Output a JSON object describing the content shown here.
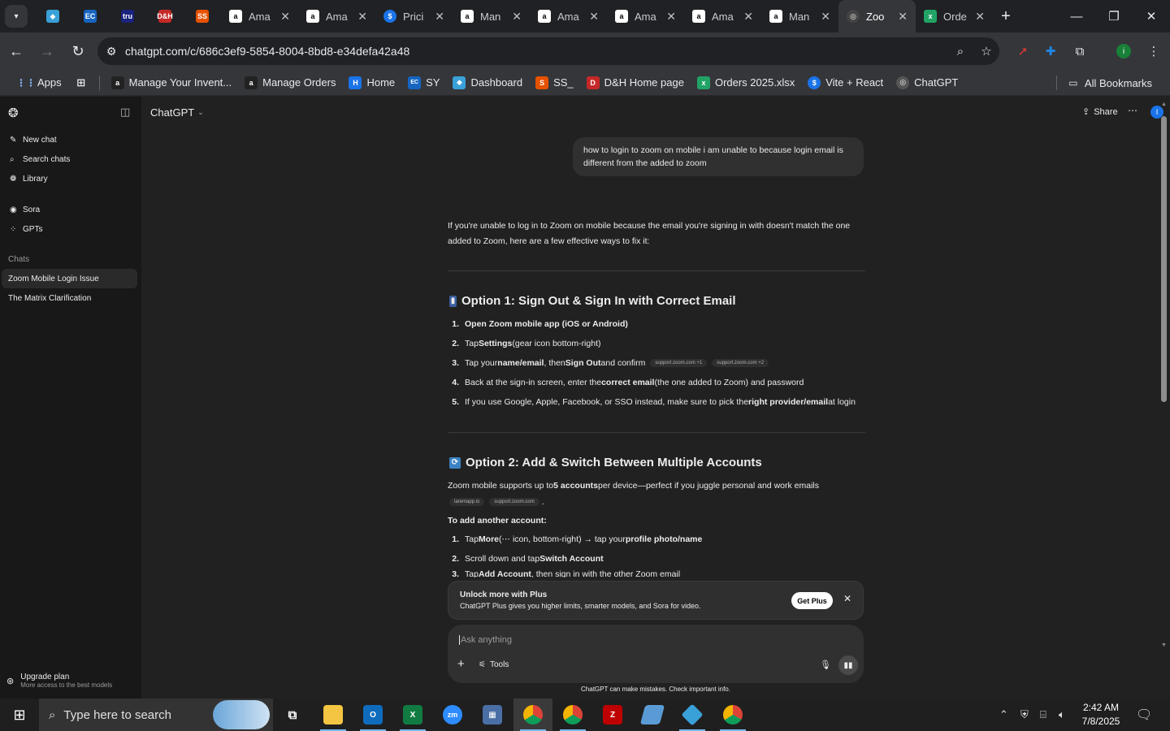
{
  "browser": {
    "tabs": [
      {
        "title": "Ama",
        "fav": "a",
        "color": "#ffffff"
      },
      {
        "title": "Ama",
        "fav": "a",
        "color": "#ffffff"
      },
      {
        "title": "Prici",
        "fav": "$",
        "color": "#1a73e8"
      },
      {
        "title": "Man",
        "fav": "a",
        "color": "#ffffff"
      },
      {
        "title": "Ama",
        "fav": "a",
        "color": "#ffffff"
      },
      {
        "title": "Ama",
        "fav": "a",
        "color": "#ffffff"
      },
      {
        "title": "Ama",
        "fav": "a",
        "color": "#ffffff"
      },
      {
        "title": "Man",
        "fav": "a",
        "color": "#ffffff"
      },
      {
        "title": "Zoo",
        "fav": "◎",
        "color": "#ffffff",
        "active": true
      },
      {
        "title": "Orde",
        "fav": "x",
        "color": "#21a366"
      }
    ],
    "pinned": [
      {
        "label": "◆",
        "color": "#3aa0d8"
      },
      {
        "label": "EC",
        "color": "#1565c0"
      },
      {
        "label": "tru",
        "color": "#1a237e"
      },
      {
        "label": "D&H",
        "color": "#c62828"
      },
      {
        "label": "SS",
        "color": "#e65100"
      }
    ],
    "url": "chatgpt.com/c/686c3ef9-5854-8004-8bd8-e34defa42a48",
    "bookmarks": [
      {
        "label": "Manage Your Invent...",
        "fav": "a",
        "color": "#222"
      },
      {
        "label": "Manage Orders",
        "fav": "a",
        "color": "#222"
      },
      {
        "label": "Home",
        "fav": "H",
        "color": "#1a73e8"
      },
      {
        "label": "SY",
        "fav": "EC",
        "color": "#1565c0"
      },
      {
        "label": "Dashboard",
        "fav": "◆",
        "color": "#3aa0d8"
      },
      {
        "label": "SS_",
        "fav": "S",
        "color": "#e65100"
      },
      {
        "label": "D&H Home page",
        "fav": "D",
        "color": "#c62828"
      },
      {
        "label": "Orders 2025.xlsx",
        "fav": "x",
        "color": "#21a366"
      },
      {
        "label": "Vite + React",
        "fav": "$",
        "color": "#1a73e8"
      },
      {
        "label": "ChatGPT",
        "fav": "◎",
        "color": "#555"
      }
    ],
    "apps_label": "Apps",
    "all_bookmarks": "All Bookmarks"
  },
  "sidebar": {
    "new_chat": "New chat",
    "search_chats": "Search chats",
    "library": "Library",
    "sora": "Sora",
    "gpts": "GPTs",
    "chats_heading": "Chats",
    "chats": [
      "Zoom Mobile Login Issue",
      "The Matrix Clarification"
    ],
    "upgrade_title": "Upgrade plan",
    "upgrade_sub": "More access to the best models"
  },
  "header": {
    "model": "ChatGPT",
    "share": "Share",
    "avatar_initial": "I"
  },
  "conversation": {
    "user_message": "how to login to zoom on mobile i am unable to because login email is different from the added to zoom",
    "intro": "If you're unable to log in to Zoom on mobile because the email you're signing in with doesn't match the one added to Zoom, here are a few effective ways to fix it:",
    "option1": {
      "title": "Option 1: Sign Out & Sign In with Correct Email",
      "items": [
        {
          "n": "1.",
          "bold": "Open Zoom mobile app (iOS or Android)",
          "rest": ""
        },
        {
          "n": "2.",
          "pre": "Tap ",
          "bold": "Settings",
          "rest": " (gear icon bottom-right)"
        },
        {
          "n": "3.",
          "pre": "Tap your ",
          "bold": "name/email",
          "mid": ", then ",
          "bold2": "Sign Out",
          "rest": " and confirm",
          "chips": [
            "support.zoom.com +1",
            "support.zoom.com +2"
          ]
        },
        {
          "n": "4.",
          "pre": "Back at the sign-in screen, enter the ",
          "bold": "correct email",
          "rest": " (the one added to Zoom) and password"
        },
        {
          "n": "5.",
          "pre": "If you use Google, Apple, Facebook, or SSO instead, make sure to pick the ",
          "bold": "right provider/email",
          "rest": " at login"
        }
      ]
    },
    "option2": {
      "title": "Option 2: Add & Switch Between Multiple Accounts",
      "intro_pre": "Zoom mobile supports up to ",
      "intro_bold": "5 accounts",
      "intro_rest": " per device—perfect if you juggle personal and work emails",
      "chips": [
        "laremapp.io",
        "support.zoom.com"
      ],
      "add_heading": "To add another account:",
      "items": [
        {
          "n": "1.",
          "pre": "Tap ",
          "bold": "More",
          "mid": " (⋯ icon, bottom-right) → tap your ",
          "bold2": "profile photo/name"
        },
        {
          "n": "2.",
          "pre": "Scroll down and tap ",
          "bold": "Switch Account"
        },
        {
          "n": "3.",
          "pre": "Tap ",
          "bold": "Add Account",
          "mid": ", then sign in with the other Zoom email"
        }
      ]
    }
  },
  "upsell": {
    "title": "Unlock more with Plus",
    "subtitle": "ChatGPT Plus gives you higher limits, smarter models, and Sora for video.",
    "button": "Get Plus"
  },
  "composer": {
    "placeholder": "Ask anything",
    "tools": "Tools",
    "disclaimer": "ChatGPT can make mistakes. Check important info."
  },
  "taskbar": {
    "search_placeholder": "Type here to search",
    "time": "2:42 AM",
    "date": "7/8/2025"
  }
}
